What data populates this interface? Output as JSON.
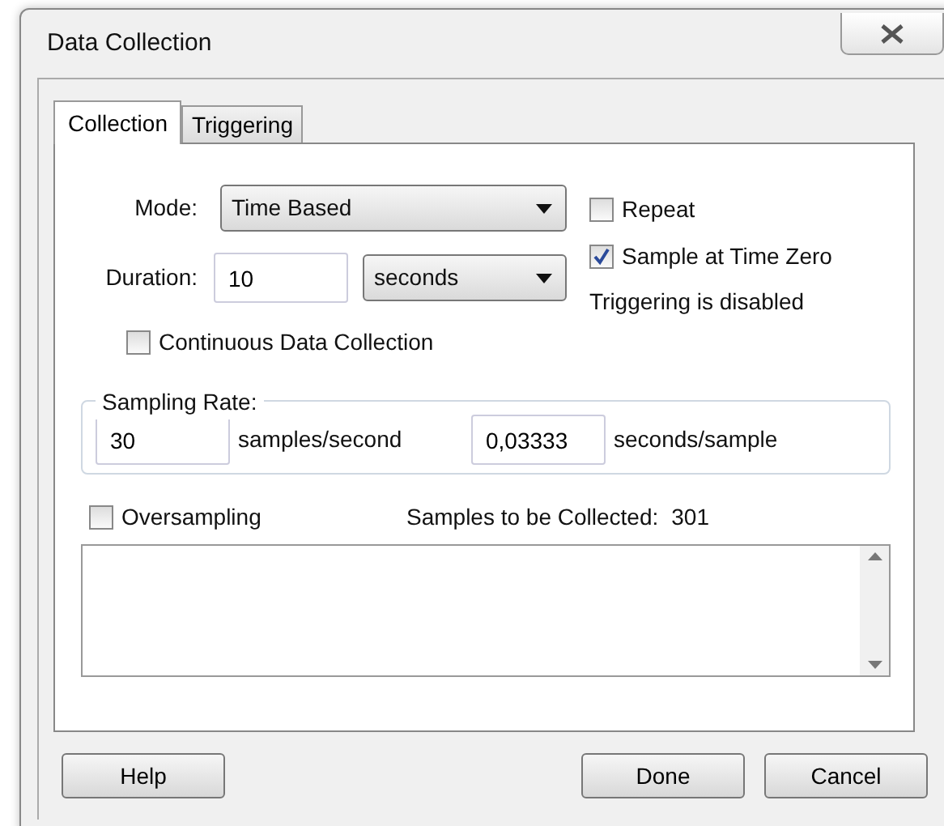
{
  "window": {
    "title": "Data Collection"
  },
  "tabs": [
    {
      "label": "Collection",
      "selected": true
    },
    {
      "label": "Triggering",
      "selected": false
    }
  ],
  "mode": {
    "label": "Mode:",
    "value": "Time Based"
  },
  "duration": {
    "label": "Duration:",
    "value": "10",
    "unit": "seconds"
  },
  "options": [
    {
      "label": "Repeat",
      "checked": false
    },
    {
      "label": "Sample at Time Zero",
      "checked": true
    }
  ],
  "trigger_status": "Triggering is disabled",
  "continuous": {
    "label": "Continuous Data Collection",
    "checked": false
  },
  "sampling_rate": {
    "legend": "Sampling Rate:",
    "rate": "30",
    "rate_unit": "samples/second",
    "period": "0,03333",
    "period_unit": "seconds/sample"
  },
  "oversampling": {
    "label": "Oversampling",
    "checked": false
  },
  "samples": {
    "label": "Samples to be Collected:",
    "value": "301"
  },
  "buttons_left": [
    "Help"
  ],
  "buttons_right": [
    "Done",
    "Cancel"
  ]
}
